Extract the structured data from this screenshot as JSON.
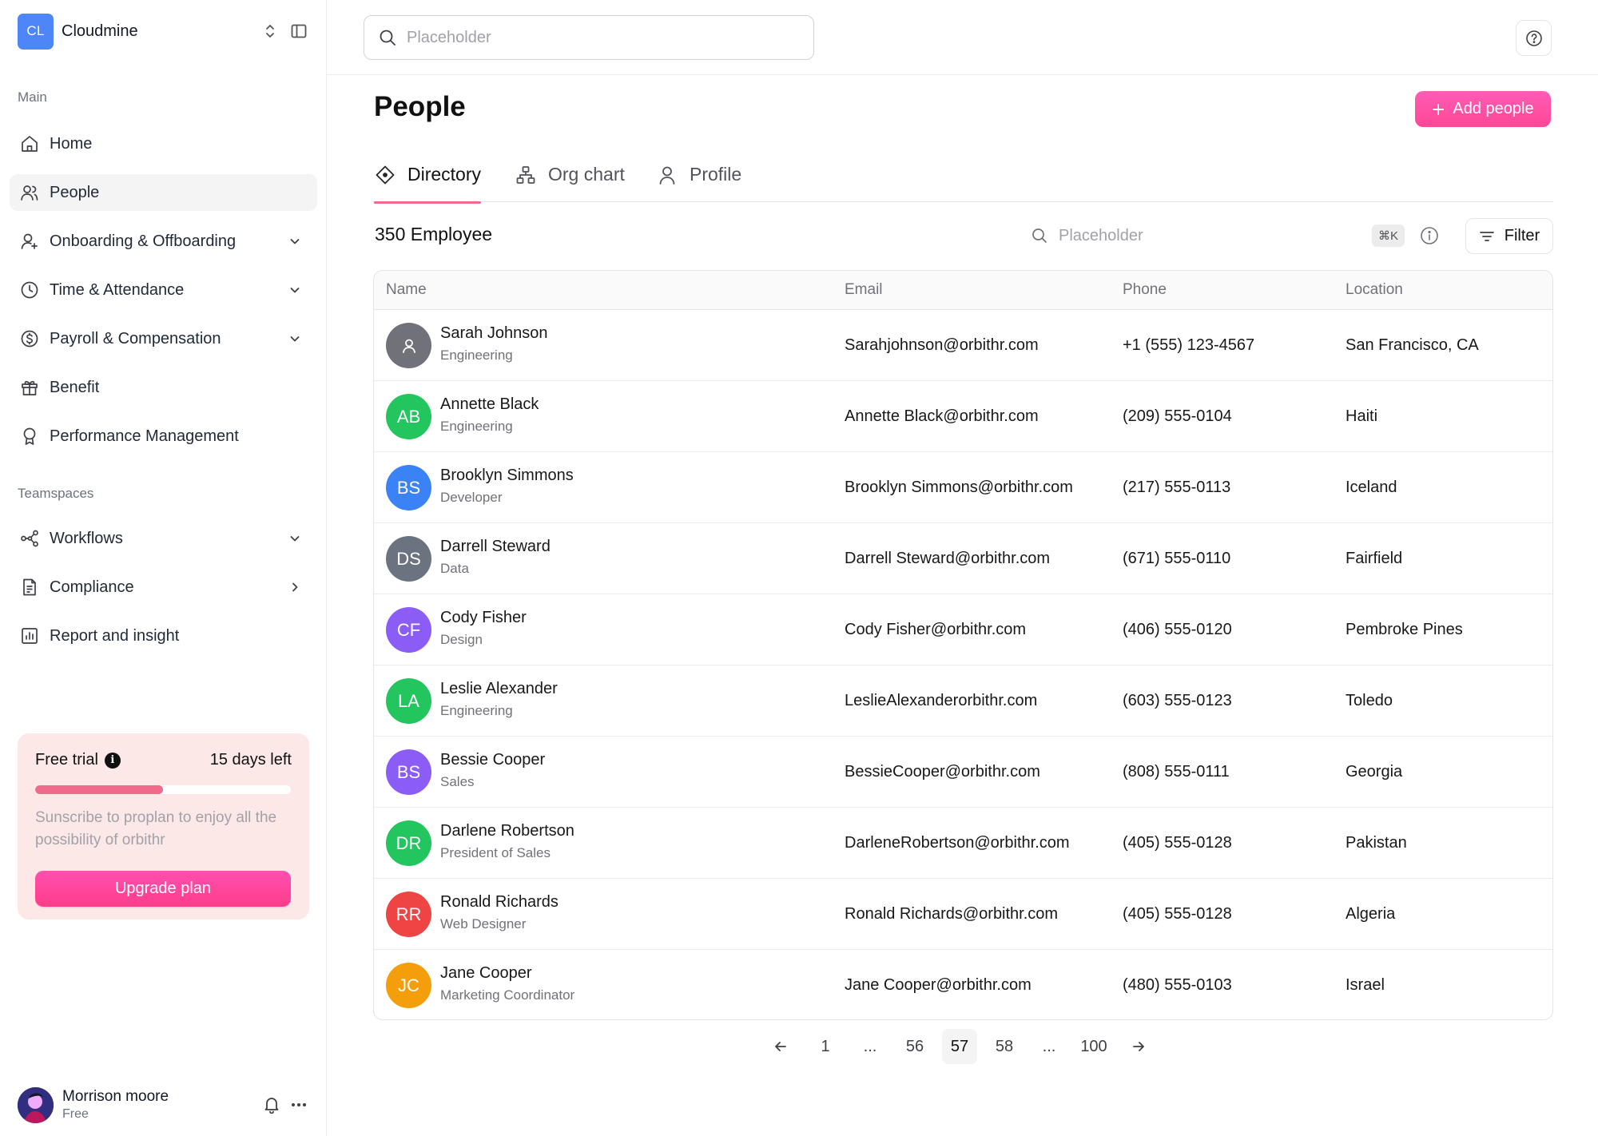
{
  "workspace": {
    "initials": "CL",
    "name": "Cloudmine"
  },
  "sidebar": {
    "main_label": "Main",
    "main_items": [
      {
        "label": "Home",
        "icon": "home-icon",
        "active": false,
        "trailing": ""
      },
      {
        "label": "People",
        "icon": "users-icon",
        "active": true,
        "trailing": ""
      },
      {
        "label": "Onboarding & Offboarding",
        "icon": "user-plus-icon",
        "active": false,
        "trailing": "chevron-down"
      },
      {
        "label": "Time & Attendance",
        "icon": "clock-icon",
        "active": false,
        "trailing": "chevron-down"
      },
      {
        "label": "Payroll & Compensation",
        "icon": "dollar-icon",
        "active": false,
        "trailing": "chevron-down"
      },
      {
        "label": "Benefit",
        "icon": "gift-icon",
        "active": false,
        "trailing": ""
      },
      {
        "label": "Performance Management",
        "icon": "award-icon",
        "active": false,
        "trailing": ""
      }
    ],
    "teamspaces_label": "Teamspaces",
    "team_items": [
      {
        "label": "Workflows",
        "icon": "workflow-icon",
        "trailing": "chevron-down"
      },
      {
        "label": "Compliance",
        "icon": "document-icon",
        "trailing": "chevron-right"
      },
      {
        "label": "Report and insight",
        "icon": "chart-icon",
        "trailing": ""
      }
    ]
  },
  "trial": {
    "title": "Free trial",
    "days_left": "15 days left",
    "progress": 0.5,
    "message": "Sunscribe to proplan to enjoy all the possibility of orbithr",
    "button": "Upgrade plan",
    "colors": {
      "background": "#fde8e8",
      "progress": "#f06a8b",
      "button": "#ff3d8b"
    }
  },
  "user": {
    "name": "Morrison moore",
    "plan": "Free"
  },
  "topbar": {
    "search_placeholder": "Placeholder"
  },
  "page": {
    "title": "People",
    "add_button": "Add people",
    "tabs": [
      {
        "label": "Directory",
        "icon": "tag-icon",
        "active": true
      },
      {
        "label": "Org chart",
        "icon": "org-chart-icon",
        "active": false
      },
      {
        "label": "Profile",
        "icon": "user-icon",
        "active": false
      }
    ],
    "employee_count": "350 Employee",
    "table_search_placeholder": "Placeholder",
    "shortcut": "⌘K",
    "filter_label": "Filter",
    "accent_color": "#ff4796"
  },
  "table": {
    "columns": [
      "Name",
      "Email",
      "Phone",
      "Location"
    ],
    "rows": [
      {
        "initials": "",
        "avatar_color": "#71717a",
        "name": "Sarah Johnson",
        "role": "Engineering",
        "email": "Sarahjohnson@orbithr.com",
        "phone": "+1 (555) 123-4567",
        "location": "San Francisco, CA"
      },
      {
        "initials": "AB",
        "avatar_color": "#22c55e",
        "name": "Annette Black",
        "role": "Engineering",
        "email": "Annette Black@orbithr.com",
        "phone": "(209) 555-0104",
        "location": "Haiti"
      },
      {
        "initials": "BS",
        "avatar_color": "#3b82f6",
        "name": "Brooklyn Simmons",
        "role": "Developer",
        "email": "Brooklyn Simmons@orbithr.com",
        "phone": "(217) 555-0113",
        "location": "Iceland"
      },
      {
        "initials": "DS",
        "avatar_color": "#6b7280",
        "name": "Darrell Steward",
        "role": "Data",
        "email": "Darrell Steward@orbithr.com",
        "phone": "(671) 555-0110",
        "location": "Fairfield"
      },
      {
        "initials": "CF",
        "avatar_color": "#8b5cf6",
        "name": "Cody Fisher",
        "role": "Design",
        "email": "Cody Fisher@orbithr.com",
        "phone": "(406) 555-0120",
        "location": "Pembroke Pines"
      },
      {
        "initials": "LA",
        "avatar_color": "#22c55e",
        "name": "Leslie Alexander",
        "role": "Engineering",
        "email": "LeslieAlexanderorbithr.com",
        "phone": "(603) 555-0123",
        "location": "Toledo"
      },
      {
        "initials": "BS",
        "avatar_color": "#8b5cf6",
        "name": "Bessie Cooper",
        "role": "Sales",
        "email": "BessieCooper@orbithr.com",
        "phone": "(808) 555-0111",
        "location": "Georgia"
      },
      {
        "initials": "DR",
        "avatar_color": "#22c55e",
        "name": "Darlene Robertson",
        "role": "President of Sales",
        "email": "DarleneRobertson@orbithr.com",
        "phone": "(405) 555-0128",
        "location": "Pakistan"
      },
      {
        "initials": "RR",
        "avatar_color": "#ef4444",
        "name": "Ronald Richards",
        "role": "Web Designer",
        "email": "Ronald Richards@orbithr.com",
        "phone": "(405) 555-0128",
        "location": "Algeria"
      },
      {
        "initials": "JC",
        "avatar_color": "#f59e0b",
        "name": "Jane Cooper",
        "role": "Marketing Coordinator",
        "email": "Jane Cooper@orbithr.com",
        "phone": "(480) 555-0103",
        "location": "Israel"
      }
    ]
  },
  "pagination": {
    "pages": [
      "1",
      "...",
      "56",
      "57",
      "58",
      "...",
      "100"
    ],
    "current": "57"
  }
}
